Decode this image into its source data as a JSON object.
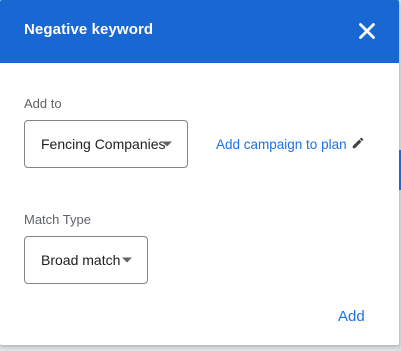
{
  "dialog": {
    "title": "Negative keyword",
    "close_icon": "close-icon"
  },
  "add_to": {
    "label": "Add to",
    "selected": "Fencing Companies",
    "link_label": "Add campaign to plan",
    "edit_icon": "pencil-icon"
  },
  "match_type": {
    "label": "Match Type",
    "selected": "Broad match"
  },
  "actions": {
    "add_label": "Add"
  },
  "colors": {
    "header": "#1967d2",
    "accent": "#1a73e8"
  }
}
